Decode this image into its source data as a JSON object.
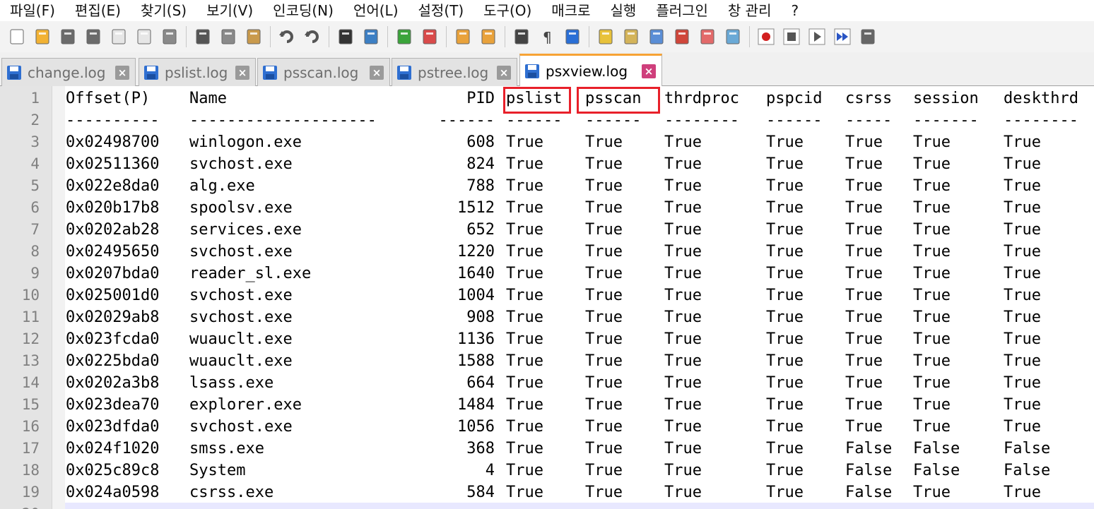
{
  "menu": [
    "파일(F)",
    "편집(E)",
    "찾기(S)",
    "보기(V)",
    "인코딩(N)",
    "언어(L)",
    "설정(T)",
    "도구(O)",
    "매크로",
    "실행",
    "플러그인",
    "창 관리",
    "?"
  ],
  "toolbar_icons": [
    "new-file-icon",
    "open-file-icon",
    "save-icon",
    "save-all-icon",
    "close-icon",
    "close-all-icon",
    "print-icon",
    "cut-icon",
    "copy-icon",
    "paste-icon",
    "undo-icon",
    "redo-icon",
    "find-icon",
    "replace-icon",
    "zoom-in-icon",
    "zoom-out-icon",
    "sync-vertical-icon",
    "sync-horizontal-icon",
    "word-wrap-icon",
    "show-all-chars-icon",
    "indent-guide-icon",
    "lang-define-icon",
    "doc-map-icon",
    "doc-list-icon",
    "function-list-icon",
    "folder-workspace-icon",
    "monitoring-icon",
    "record-macro-icon",
    "stop-record-icon",
    "playback-icon",
    "run-macro-multiple-icon",
    "save-macro-icon"
  ],
  "tabs": [
    {
      "label": "change.log",
      "active": false
    },
    {
      "label": "pslist.log",
      "active": false
    },
    {
      "label": "psscan.log",
      "active": false
    },
    {
      "label": "pstree.log",
      "active": false
    },
    {
      "label": "psxview.log",
      "active": true
    }
  ],
  "header": {
    "offset": "Offset(P)",
    "name": "Name",
    "pid": "PID",
    "pslist": "pslist",
    "psscan": "psscan",
    "thrdproc": "thrdproc",
    "pspcid": "pspcid",
    "csrss": "csrss",
    "session": "session",
    "deskthrd": "deskthrd"
  },
  "separator": {
    "offset": "----------",
    "name": "--------------------",
    "pid": "------",
    "pslist": "------",
    "psscan": "------",
    "thrdproc": "--------",
    "pspcid": "------",
    "csrss": "-----",
    "session": "-------",
    "deskthrd": "--------"
  },
  "rows": [
    {
      "offset": "0x02498700",
      "name": "winlogon.exe",
      "pid": "608",
      "pslist": "True",
      "psscan": "True",
      "thrdproc": "True",
      "pspcid": "True",
      "csrss": "True",
      "session": "True",
      "deskthrd": "True"
    },
    {
      "offset": "0x02511360",
      "name": "svchost.exe",
      "pid": "824",
      "pslist": "True",
      "psscan": "True",
      "thrdproc": "True",
      "pspcid": "True",
      "csrss": "True",
      "session": "True",
      "deskthrd": "True"
    },
    {
      "offset": "0x022e8da0",
      "name": "alg.exe",
      "pid": "788",
      "pslist": "True",
      "psscan": "True",
      "thrdproc": "True",
      "pspcid": "True",
      "csrss": "True",
      "session": "True",
      "deskthrd": "True"
    },
    {
      "offset": "0x020b17b8",
      "name": "spoolsv.exe",
      "pid": "1512",
      "pslist": "True",
      "psscan": "True",
      "thrdproc": "True",
      "pspcid": "True",
      "csrss": "True",
      "session": "True",
      "deskthrd": "True"
    },
    {
      "offset": "0x0202ab28",
      "name": "services.exe",
      "pid": "652",
      "pslist": "True",
      "psscan": "True",
      "thrdproc": "True",
      "pspcid": "True",
      "csrss": "True",
      "session": "True",
      "deskthrd": "True"
    },
    {
      "offset": "0x02495650",
      "name": "svchost.exe",
      "pid": "1220",
      "pslist": "True",
      "psscan": "True",
      "thrdproc": "True",
      "pspcid": "True",
      "csrss": "True",
      "session": "True",
      "deskthrd": "True"
    },
    {
      "offset": "0x0207bda0",
      "name": "reader_sl.exe",
      "pid": "1640",
      "pslist": "True",
      "psscan": "True",
      "thrdproc": "True",
      "pspcid": "True",
      "csrss": "True",
      "session": "True",
      "deskthrd": "True"
    },
    {
      "offset": "0x025001d0",
      "name": "svchost.exe",
      "pid": "1004",
      "pslist": "True",
      "psscan": "True",
      "thrdproc": "True",
      "pspcid": "True",
      "csrss": "True",
      "session": "True",
      "deskthrd": "True"
    },
    {
      "offset": "0x02029ab8",
      "name": "svchost.exe",
      "pid": "908",
      "pslist": "True",
      "psscan": "True",
      "thrdproc": "True",
      "pspcid": "True",
      "csrss": "True",
      "session": "True",
      "deskthrd": "True"
    },
    {
      "offset": "0x023fcda0",
      "name": "wuauclt.exe",
      "pid": "1136",
      "pslist": "True",
      "psscan": "True",
      "thrdproc": "True",
      "pspcid": "True",
      "csrss": "True",
      "session": "True",
      "deskthrd": "True"
    },
    {
      "offset": "0x0225bda0",
      "name": "wuauclt.exe",
      "pid": "1588",
      "pslist": "True",
      "psscan": "True",
      "thrdproc": "True",
      "pspcid": "True",
      "csrss": "True",
      "session": "True",
      "deskthrd": "True"
    },
    {
      "offset": "0x0202a3b8",
      "name": "lsass.exe",
      "pid": "664",
      "pslist": "True",
      "psscan": "True",
      "thrdproc": "True",
      "pspcid": "True",
      "csrss": "True",
      "session": "True",
      "deskthrd": "True"
    },
    {
      "offset": "0x023dea70",
      "name": "explorer.exe",
      "pid": "1484",
      "pslist": "True",
      "psscan": "True",
      "thrdproc": "True",
      "pspcid": "True",
      "csrss": "True",
      "session": "True",
      "deskthrd": "True"
    },
    {
      "offset": "0x023dfda0",
      "name": "svchost.exe",
      "pid": "1056",
      "pslist": "True",
      "psscan": "True",
      "thrdproc": "True",
      "pspcid": "True",
      "csrss": "True",
      "session": "True",
      "deskthrd": "True"
    },
    {
      "offset": "0x024f1020",
      "name": "smss.exe",
      "pid": "368",
      "pslist": "True",
      "psscan": "True",
      "thrdproc": "True",
      "pspcid": "True",
      "csrss": "False",
      "session": "False",
      "deskthrd": "False"
    },
    {
      "offset": "0x025c89c8",
      "name": "System",
      "pid": "4",
      "pslist": "True",
      "psscan": "True",
      "thrdproc": "True",
      "pspcid": "True",
      "csrss": "False",
      "session": "False",
      "deskthrd": "False"
    },
    {
      "offset": "0x024a0598",
      "name": "csrss.exe",
      "pid": "584",
      "pslist": "True",
      "psscan": "True",
      "thrdproc": "True",
      "pspcid": "True",
      "csrss": "False",
      "session": "True",
      "deskthrd": "True"
    }
  ],
  "highlighted_columns": [
    "pslist",
    "psscan"
  ],
  "colors": {
    "highlight": "#e8202a",
    "active_tab_accent": "#f7a335",
    "close_active": "#cf3f7c"
  }
}
